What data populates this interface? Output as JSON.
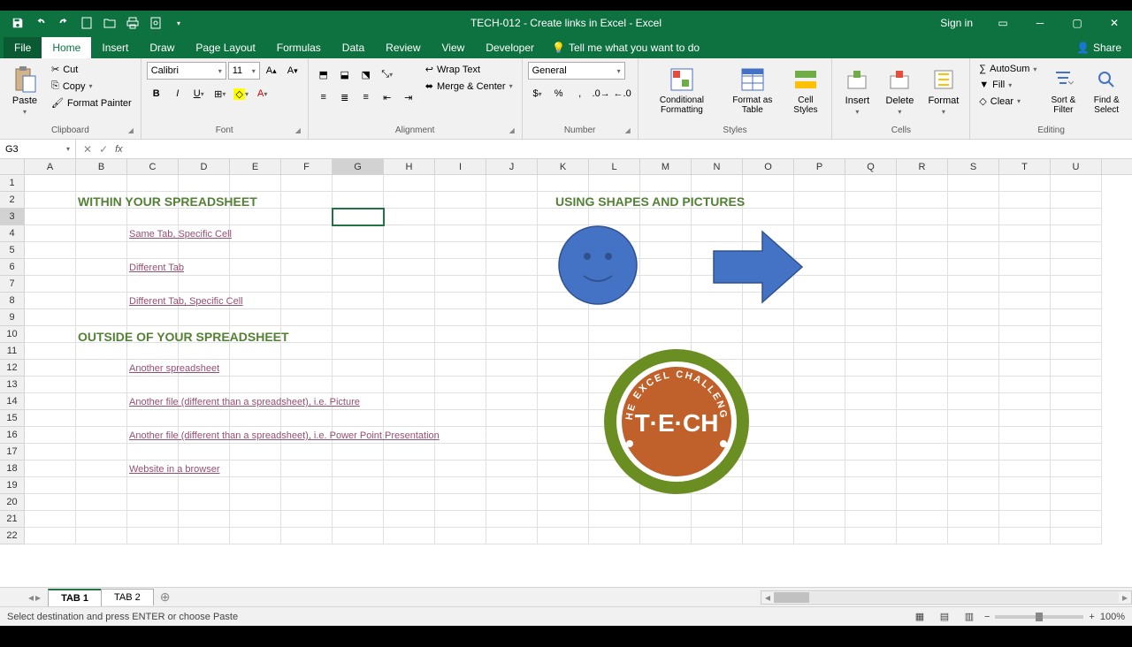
{
  "titlebar": {
    "title": "TECH-012 - Create links in Excel  -  Excel",
    "signin": "Sign in"
  },
  "ribbon_tabs": {
    "file": "File",
    "home": "Home",
    "insert": "Insert",
    "draw": "Draw",
    "page_layout": "Page Layout",
    "formulas": "Formulas",
    "data": "Data",
    "review": "Review",
    "view": "View",
    "developer": "Developer",
    "tellme": "Tell me what you want to do",
    "share": "Share"
  },
  "ribbon": {
    "clipboard": {
      "label": "Clipboard",
      "paste": "Paste",
      "cut": "Cut",
      "copy": "Copy",
      "format_painter": "Format Painter"
    },
    "font": {
      "label": "Font",
      "name": "Calibri",
      "size": "11"
    },
    "alignment": {
      "label": "Alignment",
      "wrap": "Wrap Text",
      "merge": "Merge & Center"
    },
    "number": {
      "label": "Number",
      "format": "General"
    },
    "styles": {
      "label": "Styles",
      "cond": "Conditional Formatting",
      "table": "Format as Table",
      "cell": "Cell Styles"
    },
    "cells": {
      "label": "Cells",
      "insert": "Insert",
      "delete": "Delete",
      "format": "Format"
    },
    "editing": {
      "label": "Editing",
      "autosum": "AutoSum",
      "fill": "Fill",
      "clear": "Clear",
      "sort": "Sort & Filter",
      "find": "Find & Select"
    }
  },
  "namebox": "G3",
  "content": {
    "h1": "WITHIN YOUR SPREADSHEET",
    "h2": "USING SHAPES AND PICTURES",
    "h3": "OUTSIDE OF YOUR SPREADSHEET",
    "link1": "Same Tab, Specific Cell",
    "link2": "Different Tab",
    "link3": "Different Tab, Specific Cell",
    "link4": "Another spreadsheet",
    "link5": "Another file (different than a spreadsheet), i.e. Picture",
    "link6": "Another file (different than a spreadsheet), i.e. Power Point Presentation",
    "link7": "Website in a browser"
  },
  "logo": {
    "outer": "THE EXCEL CHALLENGE",
    "inner": "T·E·CH"
  },
  "sheets": {
    "tab1": "TAB 1",
    "tab2": "TAB 2"
  },
  "status": {
    "message": "Select destination and press ENTER or choose Paste",
    "zoom": "100%"
  },
  "cols": [
    "A",
    "B",
    "C",
    "D",
    "E",
    "F",
    "G",
    "H",
    "I",
    "J",
    "K",
    "L",
    "M",
    "N",
    "O",
    "P",
    "Q",
    "R",
    "S",
    "T",
    "U"
  ]
}
